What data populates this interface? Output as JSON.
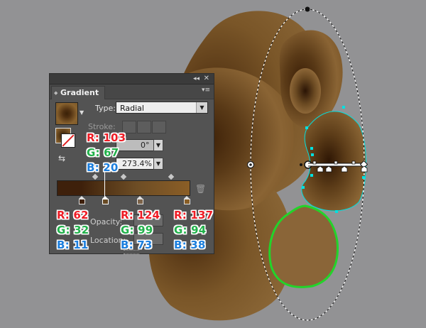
{
  "panel": {
    "tab_label": "Gradient",
    "collapse_glyph": "◂◂",
    "close_glyph": "✕",
    "menu_glyph": "▾≡",
    "type_label": "Type:",
    "type_value": "Radial",
    "stroke_label": "Stroke:",
    "angle_value": "0°",
    "aspect_value": "273.4%",
    "opacity_label": "Opacity:",
    "location_label": "Location:",
    "trash_icon": "trash-icon"
  },
  "gradient": {
    "stop_colors": [
      "#3e200b",
      "#674a24",
      "#7c6349",
      "#895e26"
    ],
    "selected_stop": 1
  },
  "annotations": {
    "top": {
      "r": "R: 103",
      "g": "G: 67",
      "b": "B: 20"
    },
    "stop1": {
      "r": "R: 62",
      "g": "G: 32",
      "b": "B: 11"
    },
    "stop2": {
      "r": "R: 124",
      "g": "G: 99",
      "b": "B: 73"
    },
    "stop3": {
      "r": "R: 137",
      "g": "G: 94",
      "b": "B: 38"
    }
  },
  "colors": {
    "annotation_red": "#ee1c25",
    "annotation_green": "#21b14a",
    "annotation_blue": "#1c7fde",
    "selection_path": "#00e0e0",
    "petal_outline": "#1dd11d"
  }
}
